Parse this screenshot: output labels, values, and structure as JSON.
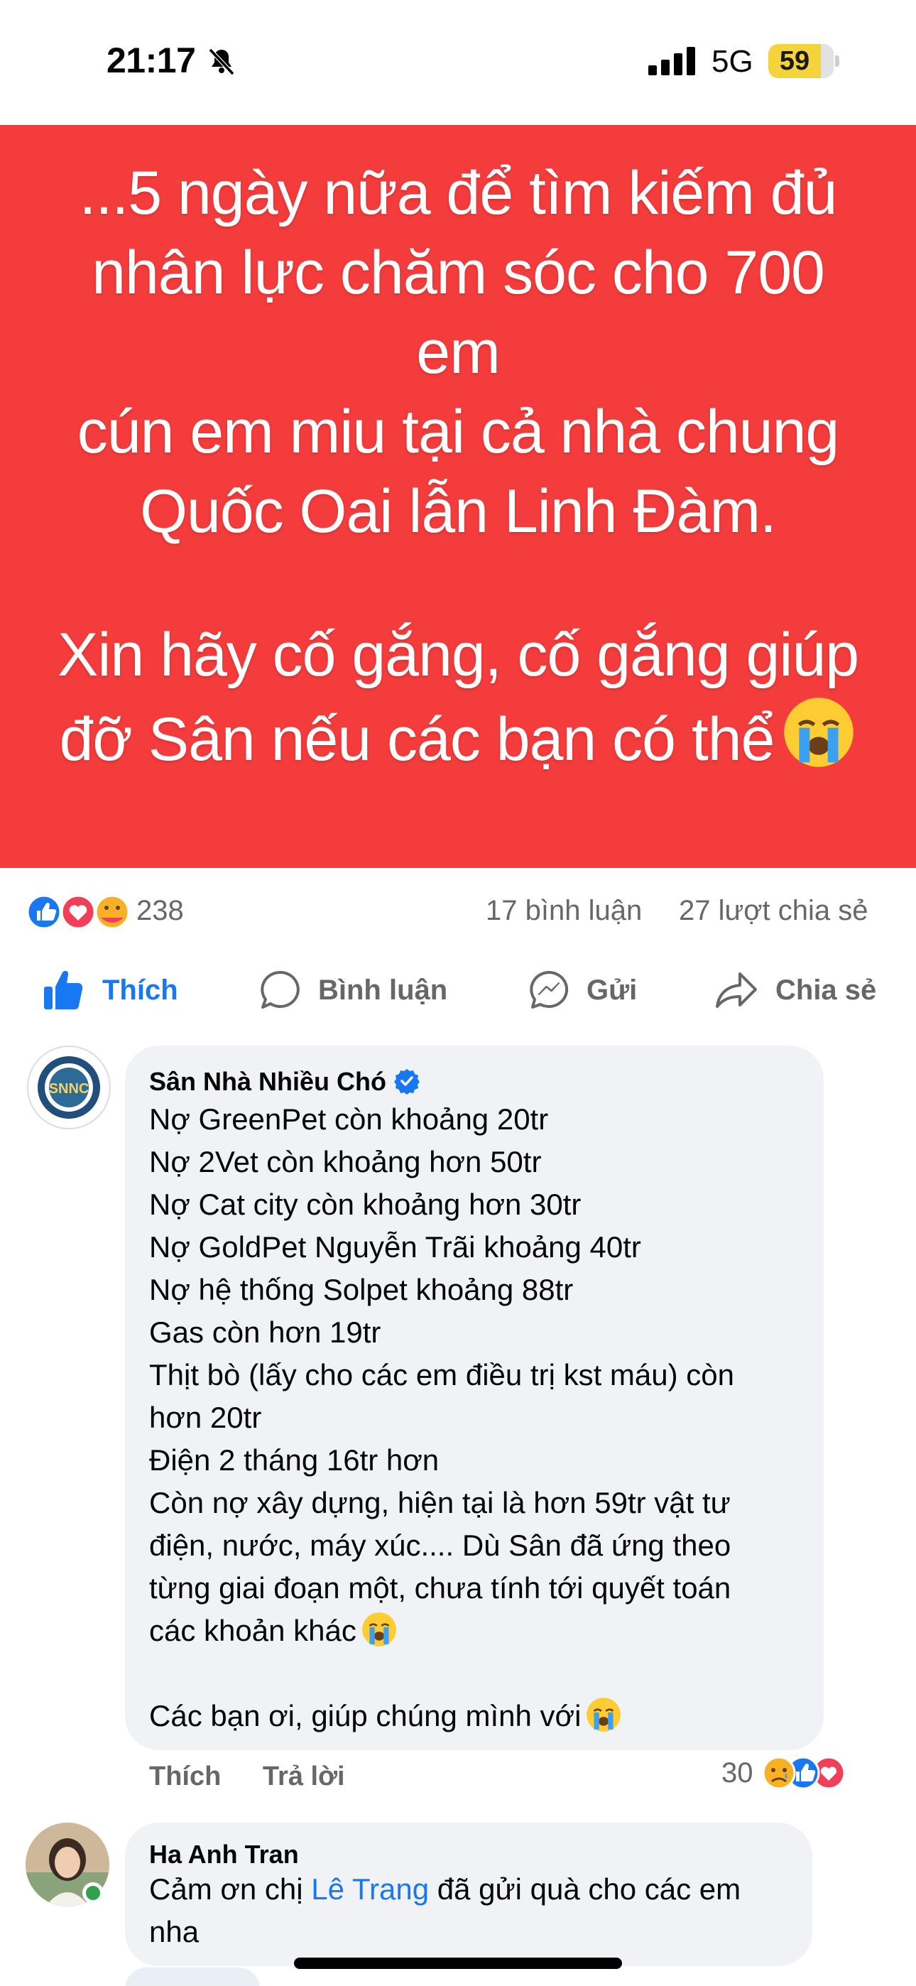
{
  "status_bar": {
    "time": "21:17",
    "network": "5G",
    "battery": "59",
    "icons": [
      "bell-slash-icon",
      "signal-bars-icon",
      "battery-icon"
    ]
  },
  "post": {
    "banner_lines_1": [
      "...5 ngày nữa để tìm kiếm đủ",
      "nhân lực chăm sóc cho 700 em",
      "cún em miu tại cả nhà chung",
      "Quốc Oai lẫn Linh Đàm."
    ],
    "banner_lines_2": [
      "Xin hãy cố gắng, cố gắng giúp",
      "đỡ Sân nếu các bạn có thể"
    ],
    "banner_color": "#f43c3c"
  },
  "reactions": {
    "icons": [
      "like-icon",
      "love-icon",
      "care-icon"
    ],
    "count": "238",
    "comments": "17 bình luận",
    "shares": "27 lượt chia sẻ"
  },
  "actions": {
    "like": "Thích",
    "comment": "Bình luận",
    "send": "Gửi",
    "share": "Chia sẻ"
  },
  "comments": [
    {
      "author": "Sân Nhà Nhiều Chó",
      "avatar_text": "SNNC",
      "verified": true,
      "lines": [
        "Nợ GreenPet còn khoảng 20tr",
        "Nợ 2Vet còn khoảng hơn 50tr",
        "Nợ Cat city còn khoảng hơn 30tr",
        "Nợ GoldPet Nguyễn Trãi khoảng 40tr",
        "Nợ hệ thống Solpet khoảng 88tr",
        "Gas còn hơn 19tr",
        "Thịt bò (lấy cho các em điều trị kst máu) còn",
        "hơn 20tr",
        "Điện 2 tháng 16tr hơn",
        "Còn nợ xây dựng, hiện tại là hơn 59tr vật tư",
        "điện, nước, máy xúc.... Dù Sân đã ứng theo",
        "từng giai đoạn một, chưa tính tới quyết toán",
        "các khoản khác"
      ],
      "closing": "Các bạn ơi, giúp chúng mình với",
      "like_label": "Thích",
      "reply_label": "Trả lời",
      "reaction_count": "30"
    },
    {
      "author": "Ha Anh Tran",
      "text_before": "Cảm ơn chị ",
      "mention": "Lê Trang",
      "text_after": " đã gửi quà cho các em",
      "line2": "nha"
    }
  ]
}
